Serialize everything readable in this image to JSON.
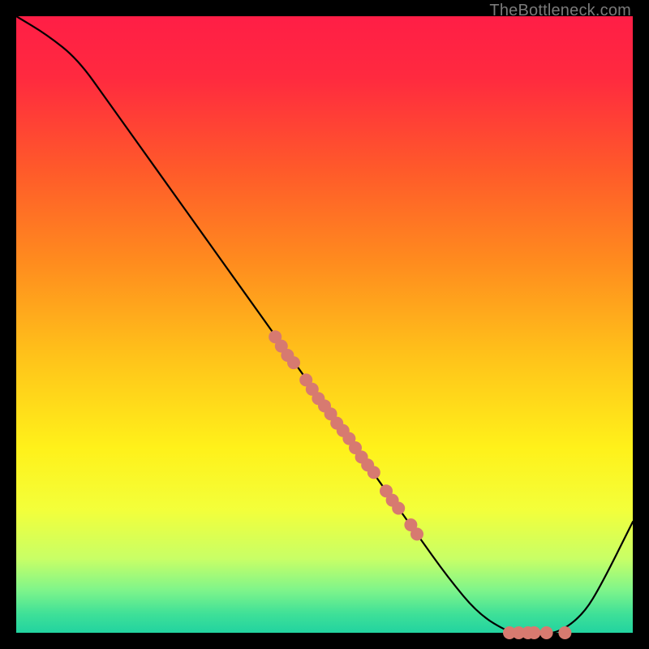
{
  "watermark": "TheBottleneck.com",
  "colors": {
    "gradient_stops": [
      {
        "offset": 0.0,
        "color": "#ff1e46"
      },
      {
        "offset": 0.1,
        "color": "#ff2a3f"
      },
      {
        "offset": 0.25,
        "color": "#ff5a2a"
      },
      {
        "offset": 0.4,
        "color": "#ff8c1e"
      },
      {
        "offset": 0.55,
        "color": "#ffc21a"
      },
      {
        "offset": 0.7,
        "color": "#fff11a"
      },
      {
        "offset": 0.8,
        "color": "#f3ff3a"
      },
      {
        "offset": 0.88,
        "color": "#c8ff66"
      },
      {
        "offset": 0.93,
        "color": "#80f58a"
      },
      {
        "offset": 0.97,
        "color": "#3ee098"
      },
      {
        "offset": 1.0,
        "color": "#22d3a0"
      }
    ],
    "curve": "#000000",
    "dot_fill": "#d77a70",
    "background": "#000000"
  },
  "chart_data": {
    "type": "line",
    "title": "",
    "xlabel": "",
    "ylabel": "",
    "xlim": [
      0,
      100
    ],
    "ylim": [
      0,
      100
    ],
    "grid": false,
    "series": [
      {
        "name": "curve",
        "x": [
          0,
          5,
          10,
          15,
          20,
          25,
          30,
          35,
          40,
          45,
          50,
          55,
          60,
          65,
          70,
          75,
          80,
          82,
          85,
          88,
          92,
          95,
          100
        ],
        "y": [
          100,
          97,
          93,
          86,
          79,
          72,
          65,
          58,
          51,
          44,
          37,
          30,
          23,
          16,
          9,
          3,
          0,
          0,
          0,
          0,
          3,
          8,
          18
        ]
      }
    ],
    "scatter": {
      "name": "dots-on-curve",
      "points": [
        {
          "x": 42,
          "y": 48
        },
        {
          "x": 43,
          "y": 46.5
        },
        {
          "x": 44,
          "y": 45
        },
        {
          "x": 45,
          "y": 43.8
        },
        {
          "x": 47,
          "y": 41
        },
        {
          "x": 48,
          "y": 39.5
        },
        {
          "x": 49,
          "y": 38
        },
        {
          "x": 50,
          "y": 36.8
        },
        {
          "x": 51,
          "y": 35.5
        },
        {
          "x": 52,
          "y": 34
        },
        {
          "x": 53,
          "y": 32.8
        },
        {
          "x": 54,
          "y": 31.5
        },
        {
          "x": 55,
          "y": 30
        },
        {
          "x": 56,
          "y": 28.5
        },
        {
          "x": 57,
          "y": 27.2
        },
        {
          "x": 58,
          "y": 26
        },
        {
          "x": 60,
          "y": 23
        },
        {
          "x": 61,
          "y": 21.5
        },
        {
          "x": 62,
          "y": 20.2
        },
        {
          "x": 64,
          "y": 17.5
        },
        {
          "x": 65,
          "y": 16
        },
        {
          "x": 80,
          "y": 0
        },
        {
          "x": 81.5,
          "y": 0
        },
        {
          "x": 83,
          "y": 0
        },
        {
          "x": 84,
          "y": 0
        },
        {
          "x": 86,
          "y": 0
        },
        {
          "x": 89,
          "y": 0
        }
      ]
    }
  }
}
